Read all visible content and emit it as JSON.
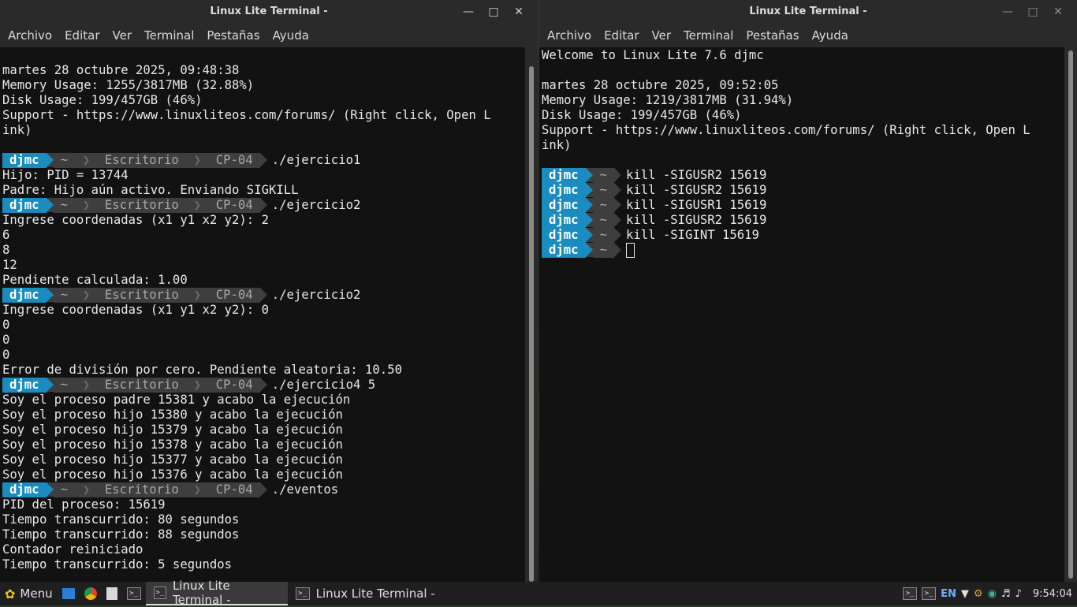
{
  "left_window": {
    "title": "Linux Lite Terminal -",
    "menu": [
      "Archivo",
      "Editar",
      "Ver",
      "Terminal",
      "Pestañas",
      "Ayuda"
    ],
    "lines": [
      {
        "t": "text",
        "v": "martes 28 octubre 2025, 09:48:38"
      },
      {
        "t": "text",
        "v": "Memory Usage: 1255/3817MB (32.88%)"
      },
      {
        "t": "text",
        "v": "Disk Usage: 199/457GB (46%)"
      },
      {
        "t": "text",
        "v": "Support - https://www.linuxliteos.com/forums/ (Right click, Open L"
      },
      {
        "t": "text",
        "v": "ink)"
      },
      {
        "t": "text",
        "v": ""
      },
      {
        "t": "prompt",
        "user": "djmc",
        "path": [
          "~",
          "Escritorio",
          "CP-04"
        ],
        "cmd": "./ejercicio1"
      },
      {
        "t": "text",
        "v": "Hijo: PID = 13744"
      },
      {
        "t": "text",
        "v": "Padre: Hijo aún activo. Enviando SIGKILL"
      },
      {
        "t": "prompt",
        "user": "djmc",
        "path": [
          "~",
          "Escritorio",
          "CP-04"
        ],
        "cmd": "./ejercicio2"
      },
      {
        "t": "text",
        "v": "Ingrese coordenadas (x1 y1 x2 y2): 2"
      },
      {
        "t": "text",
        "v": "6"
      },
      {
        "t": "text",
        "v": "8"
      },
      {
        "t": "text",
        "v": "12"
      },
      {
        "t": "text",
        "v": "Pendiente calculada: 1.00"
      },
      {
        "t": "prompt",
        "user": "djmc",
        "path": [
          "~",
          "Escritorio",
          "CP-04"
        ],
        "cmd": "./ejercicio2"
      },
      {
        "t": "text",
        "v": "Ingrese coordenadas (x1 y1 x2 y2): 0"
      },
      {
        "t": "text",
        "v": "0"
      },
      {
        "t": "text",
        "v": "0"
      },
      {
        "t": "text",
        "v": "0"
      },
      {
        "t": "text",
        "v": "Error de división por cero. Pendiente aleatoria: 10.50"
      },
      {
        "t": "prompt",
        "user": "djmc",
        "path": [
          "~",
          "Escritorio",
          "CP-04"
        ],
        "cmd": "./ejercicio4 5"
      },
      {
        "t": "text",
        "v": "Soy el proceso padre 15381 y acabo la ejecución"
      },
      {
        "t": "text",
        "v": "Soy el proceso hijo 15380 y acabo la ejecución"
      },
      {
        "t": "text",
        "v": "Soy el proceso hijo 15379 y acabo la ejecución"
      },
      {
        "t": "text",
        "v": "Soy el proceso hijo 15378 y acabo la ejecución"
      },
      {
        "t": "text",
        "v": "Soy el proceso hijo 15377 y acabo la ejecución"
      },
      {
        "t": "text",
        "v": "Soy el proceso hijo 15376 y acabo la ejecución"
      },
      {
        "t": "prompt",
        "user": "djmc",
        "path": [
          "~",
          "Escritorio",
          "CP-04"
        ],
        "cmd": "./eventos"
      },
      {
        "t": "text",
        "v": "PID del proceso: 15619"
      },
      {
        "t": "text",
        "v": "Tiempo transcurrido: 80 segundos"
      },
      {
        "t": "text",
        "v": "Tiempo transcurrido: 88 segundos"
      },
      {
        "t": "text",
        "v": "Contador reiniciado"
      },
      {
        "t": "text",
        "v": "Tiempo transcurrido: 5 segundos"
      }
    ]
  },
  "right_window": {
    "title": "Linux Lite Terminal -",
    "menu": [
      "Archivo",
      "Editar",
      "Ver",
      "Terminal",
      "Pestañas",
      "Ayuda"
    ],
    "lines": [
      {
        "t": "text",
        "v": "Welcome to Linux Lite 7.6 djmc"
      },
      {
        "t": "text",
        "v": ""
      },
      {
        "t": "text",
        "v": "martes 28 octubre 2025, 09:52:05"
      },
      {
        "t": "text",
        "v": "Memory Usage: 1219/3817MB (31.94%)"
      },
      {
        "t": "text",
        "v": "Disk Usage: 199/457GB (46%)"
      },
      {
        "t": "text",
        "v": "Support - https://www.linuxliteos.com/forums/ (Right click, Open L"
      },
      {
        "t": "text",
        "v": "ink)"
      },
      {
        "t": "text",
        "v": ""
      },
      {
        "t": "prompt",
        "user": "djmc",
        "path": [
          "~"
        ],
        "cmd": "kill -SIGUSR2 15619"
      },
      {
        "t": "prompt",
        "user": "djmc",
        "path": [
          "~"
        ],
        "cmd": "kill -SIGUSR2 15619"
      },
      {
        "t": "prompt",
        "user": "djmc",
        "path": [
          "~"
        ],
        "cmd": "kill -SIGUSR1 15619"
      },
      {
        "t": "prompt",
        "user": "djmc",
        "path": [
          "~"
        ],
        "cmd": "kill -SIGUSR2 15619"
      },
      {
        "t": "prompt",
        "user": "djmc",
        "path": [
          "~"
        ],
        "cmd": "kill -SIGINT 15619"
      },
      {
        "t": "prompt",
        "user": "djmc",
        "path": [
          "~"
        ],
        "cmd": "",
        "cursor": true
      }
    ]
  },
  "taskbar": {
    "menu_label": "Menu",
    "windows": [
      {
        "label": "Linux Lite Terminal -",
        "active": true
      },
      {
        "label": "Linux Lite Terminal -",
        "active": false
      }
    ],
    "keyboard_layout": "EN",
    "clock": "9:54:04"
  },
  "icons": {
    "minimize": "minimize-icon",
    "maximize": "maximize-icon",
    "close": "close-icon",
    "menu": "linux-lite-feather-icon",
    "files": "file-manager-icon",
    "browser": "chrome-icon",
    "notes": "notes-icon",
    "terminal": "terminal-icon",
    "wifi": "wifi-icon",
    "volume": "volume-icon",
    "bell": "notification-bell-icon"
  },
  "colors": {
    "prompt_user_bg": "#1a8cc0",
    "prompt_dir_bg": "#3e3e3e",
    "terminal_bg": "#121212"
  }
}
